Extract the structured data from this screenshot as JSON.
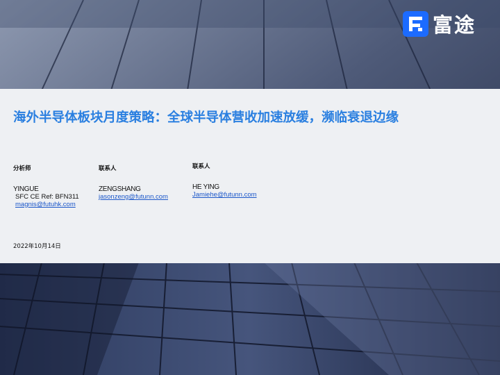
{
  "brand": {
    "name": "富途"
  },
  "report": {
    "title": "海外半导体板块月度策略：全球半导体营收加速放缓，濒临衰退边缘",
    "date": "2022年10月14日"
  },
  "authors": [
    {
      "role": "分析师",
      "name": "YINGUE",
      "ref": "SFC CE Ref: BFN311",
      "email": "magnis@futuhk.com"
    },
    {
      "role": "联系人",
      "name": "ZENGSHANG",
      "email": "jasonzeng@futunn.com"
    },
    {
      "role": "联系人",
      "name": "HE YING",
      "email": "Jamiehe@futunn.com"
    }
  ],
  "colors": {
    "accent": "#2a7fe0",
    "brand": "#1c6bff",
    "panel": "#eef0f3"
  }
}
